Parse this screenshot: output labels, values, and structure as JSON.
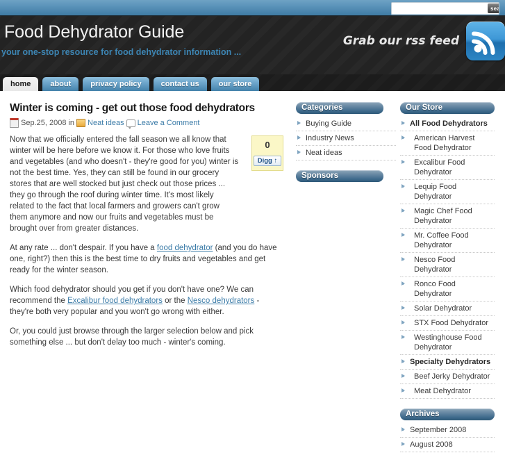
{
  "topbar": {
    "search": {
      "value": "",
      "placeholder": "",
      "button_label": "search",
      "icon": "search-icon"
    }
  },
  "header": {
    "site_title": "Food Dehydrator Guide",
    "tagline": "your one-stop resource for food dehydrator information ...",
    "rss_text": "Grab our rss feed",
    "rss_icon": "rss-feed-icon",
    "accent_color": "#3d85b3",
    "background_color": "#232323"
  },
  "nav": {
    "tabs": [
      {
        "label": "home",
        "active": true
      },
      {
        "label": "about",
        "active": false
      },
      {
        "label": "privacy policy",
        "active": false
      },
      {
        "label": "contact us",
        "active": false
      },
      {
        "label": "our store",
        "active": false
      }
    ]
  },
  "post": {
    "title": "Winter is coming - get out those food dehydrators",
    "meta": {
      "date_icon": "calendar-icon",
      "date": "Sep.25, 2008",
      "in_label": "in",
      "category_icon": "folder-icon",
      "category": "Neat ideas",
      "comment_icon": "comment-bubble-icon",
      "comment_link": "Leave a Comment"
    },
    "paragraphs": [
      "Now that we officially entered the fall season we all know that winter will be here before we know it. For those who love fruits and vegetables (and who doesn't - they're good for you) winter is not the best time. Yes, they can still be found in our grocery stores that are well stocked but just check out those prices ... they go through the roof during winter time. It's most likely related to the fact that local farmers and growers can't grow them anymore and now our fruits and vegetables must be brought over from greater distances.",
      "Or, you could just browse through the larger selection below and pick something else ... but don't delay too much - winter's coming."
    ],
    "p2_pre": "At any rate ... don't despair. If you have a ",
    "p2_link": "food dehydrator",
    "p2_post": " (and you do have one, right?) then this is the best time to dry fruits and vegetables and get ready for the winter season.",
    "p3_pre": "Which food dehydrator should you get if you don't have one? We can recommend the ",
    "p3_link1": "Excalibur food dehydrators",
    "p3_mid": " or the ",
    "p3_link2": "Nesco dehydrators",
    "p3_post": " - they're both very popular and you won't go wrong with either.",
    "digg": {
      "count": "0",
      "button_label": "Digg ↑"
    }
  },
  "sidebar_mid": {
    "widgets": [
      {
        "title": "Categories",
        "items": [
          {
            "label": "Buying Guide",
            "bold": false,
            "sub": false
          },
          {
            "label": "Industry News",
            "bold": false,
            "sub": false
          },
          {
            "label": "Neat ideas",
            "bold": false,
            "sub": false
          }
        ]
      },
      {
        "title": "Sponsors",
        "items": []
      }
    ]
  },
  "sidebar_right": {
    "widgets": [
      {
        "title": "Our Store",
        "items": [
          {
            "label": "All Food Dehydrators",
            "bold": true,
            "sub": false
          },
          {
            "label": "American Harvest Food Dehydrator",
            "bold": false,
            "sub": true
          },
          {
            "label": "Excalibur Food Dehydrator",
            "bold": false,
            "sub": true
          },
          {
            "label": "Lequip Food Dehydrator",
            "bold": false,
            "sub": true
          },
          {
            "label": "Magic Chef Food Dehydrator",
            "bold": false,
            "sub": true
          },
          {
            "label": "Mr. Coffee Food Dehydrator",
            "bold": false,
            "sub": true
          },
          {
            "label": "Nesco Food Dehydrator",
            "bold": false,
            "sub": true
          },
          {
            "label": "Ronco Food Dehydrator",
            "bold": false,
            "sub": true
          },
          {
            "label": "Solar Dehydrator",
            "bold": false,
            "sub": true
          },
          {
            "label": "STX Food Dehydrator",
            "bold": false,
            "sub": true
          },
          {
            "label": "Westinghouse Food Dehydrator",
            "bold": false,
            "sub": true
          },
          {
            "label": "Specialty Dehydrators",
            "bold": true,
            "sub": false
          },
          {
            "label": "Beef Jerky Dehydrator",
            "bold": false,
            "sub": true
          },
          {
            "label": "Meat Dehydrator",
            "bold": false,
            "sub": true
          }
        ]
      },
      {
        "title": "Archives",
        "items": [
          {
            "label": "September 2008",
            "bold": false,
            "sub": false
          },
          {
            "label": "August 2008",
            "bold": false,
            "sub": false
          }
        ]
      }
    ]
  }
}
